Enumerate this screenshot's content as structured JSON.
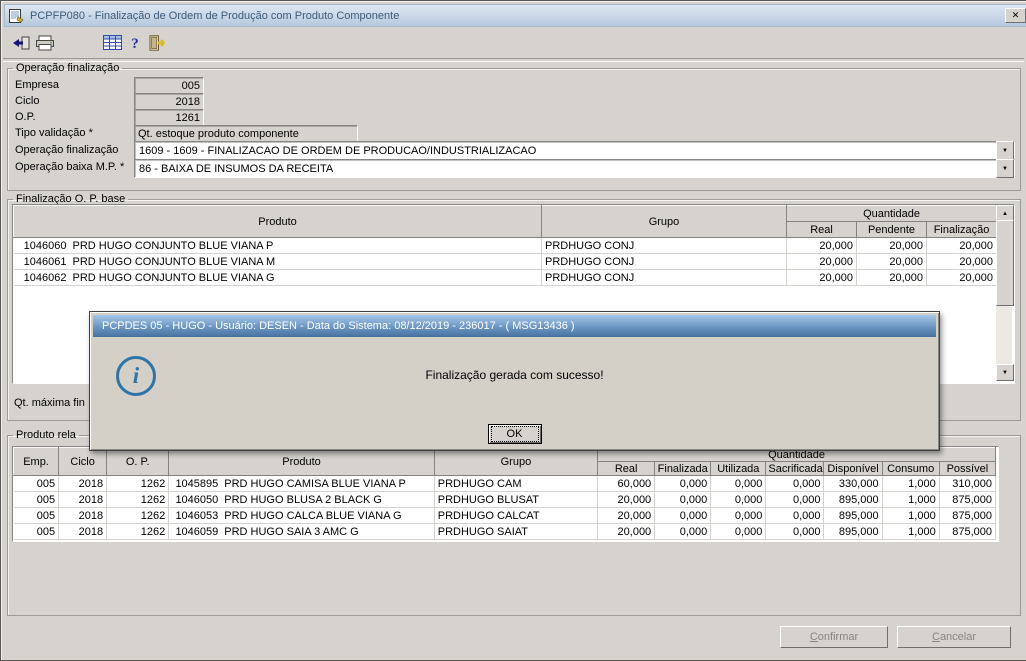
{
  "window": {
    "title": "PCPFP080 - Finalização de Ordem de Produção com Produto Componente"
  },
  "icons": {
    "close": "✕",
    "help": "?",
    "dropdown_arrow": "▼",
    "scroll_up": "▲",
    "scroll_down": "▼",
    "info": "i"
  },
  "toolbar": {
    "buttons": [
      "transfer-icon",
      "printer-icon",
      "grid-icon",
      "help-icon",
      "exit-door-icon"
    ]
  },
  "operacao": {
    "legend": "Operação finalização",
    "empresa_label": "Empresa",
    "empresa_value": "005",
    "ciclo_label": "Ciclo",
    "ciclo_value": "2018",
    "op_label": "O.P.",
    "op_value": "1261",
    "tipo_label": "Tipo validação *",
    "tipo_value": "Qt. estoque produto componente",
    "opfin_label": "Operação finalização",
    "opfin_value": "1609 - 1609 - FINALIZACAO DE ORDEM DE PRODUCAO/INDUSTRIALIZACAO",
    "baixa_label": "Operação baixa M.P. *",
    "baixa_value": "86 - BAIXA DE INSUMOS DA RECEITA"
  },
  "base": {
    "legend": "Finalização O. P. base",
    "headers": {
      "produto": "Produto",
      "grupo": "Grupo",
      "quantidade": "Quantidade",
      "real": "Real",
      "pendente": "Pendente",
      "finalizacao": "Finalização"
    },
    "rows": [
      {
        "codigo": "1046060",
        "produto": "PRD HUGO CONJUNTO BLUE VIANA P",
        "grupo": "PRDHUGO CONJ",
        "real": "20,000",
        "pendente": "20,000",
        "finalizacao": "20,000"
      },
      {
        "codigo": "1046061",
        "produto": "PRD HUGO CONJUNTO BLUE VIANA M",
        "grupo": "PRDHUGO CONJ",
        "real": "20,000",
        "pendente": "20,000",
        "finalizacao": "20,000"
      },
      {
        "codigo": "1046062",
        "produto": "PRD HUGO CONJUNTO BLUE VIANA G",
        "grupo": "PRDHUGO CONJ",
        "real": "20,000",
        "pendente": "20,000",
        "finalizacao": "20,000"
      }
    ],
    "footer_label": "Qt. máxima fin"
  },
  "dialog": {
    "title": "PCPDES 05 - HUGO - Usuário: DESEN - Data do Sistema: 08/12/2019 - 236017 - ( MSG13436 )",
    "message": "Finalização gerada com sucesso!",
    "ok_label": "OK"
  },
  "relacionado": {
    "legend": "Produto rela",
    "headers": {
      "emp": "Emp.",
      "ciclo": "Ciclo",
      "op": "O. P.",
      "produto": "Produto",
      "grupo": "Grupo",
      "quantidade": "Quantidade",
      "real": "Real",
      "finalizada": "Finalizada",
      "utilizada": "Utilizada",
      "sacrificada": "Sacrificada",
      "disponivel": "Disponível",
      "consumo": "Consumo",
      "possivel": "Possível"
    },
    "rows": [
      {
        "emp": "005",
        "ciclo": "2018",
        "op": "1262",
        "codigo": "1045895",
        "produto": "PRD HUGO CAMISA BLUE VIANA P",
        "grupo": "PRDHUGO CAM",
        "real": "60,000",
        "finalizada": "0,000",
        "utilizada": "0,000",
        "sacrificada": "0,000",
        "disponivel": "330,000",
        "consumo": "1,000",
        "possivel": "310,000"
      },
      {
        "emp": "005",
        "ciclo": "2018",
        "op": "1262",
        "codigo": "1046050",
        "produto": "PRD HUGO BLUSA 2 BLACK G",
        "grupo": "PRDHUGO BLUSAT",
        "real": "20,000",
        "finalizada": "0,000",
        "utilizada": "0,000",
        "sacrificada": "0,000",
        "disponivel": "895,000",
        "consumo": "1,000",
        "possivel": "875,000"
      },
      {
        "emp": "005",
        "ciclo": "2018",
        "op": "1262",
        "codigo": "1046053",
        "produto": "PRD HUGO CALCA BLUE VIANA G",
        "grupo": "PRDHUGO CALCAT",
        "real": "20,000",
        "finalizada": "0,000",
        "utilizada": "0,000",
        "sacrificada": "0,000",
        "disponivel": "895,000",
        "consumo": "1,000",
        "possivel": "875,000"
      },
      {
        "emp": "005",
        "ciclo": "2018",
        "op": "1262",
        "codigo": "1046059",
        "produto": "PRD HUGO SAIA 3 AMC G",
        "grupo": "PRDHUGO SAIAT",
        "real": "20,000",
        "finalizada": "0,000",
        "utilizada": "0,000",
        "sacrificada": "0,000",
        "disponivel": "895,000",
        "consumo": "1,000",
        "possivel": "875,000"
      }
    ]
  },
  "footer": {
    "confirmar": "Confirmar",
    "cancelar": "Cancelar"
  }
}
